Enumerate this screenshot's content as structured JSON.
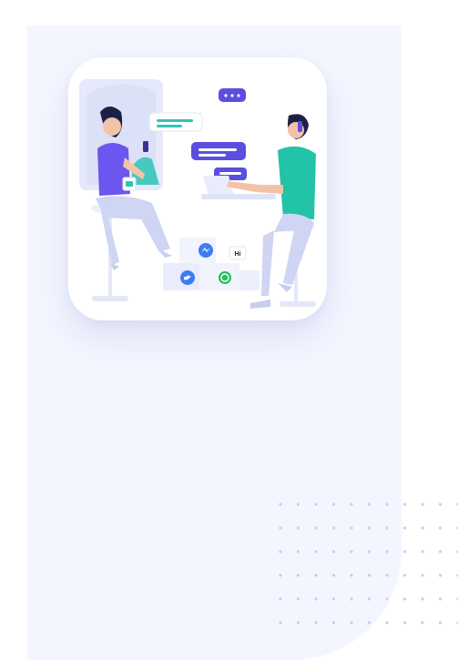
{
  "illustration": {
    "bubble_text": "Hi",
    "social_icons": [
      "messenger-icon",
      "twitter-icon",
      "whatsapp-icon"
    ]
  },
  "colors": {
    "panel_background": "#f4f6ff",
    "dot_color": "#c9cdf0",
    "accent_purple": "#5b4fe0",
    "accent_teal": "#2ec4b6",
    "shirt_purple": "#6b56f0",
    "shirt_teal": "#22c3a6"
  }
}
